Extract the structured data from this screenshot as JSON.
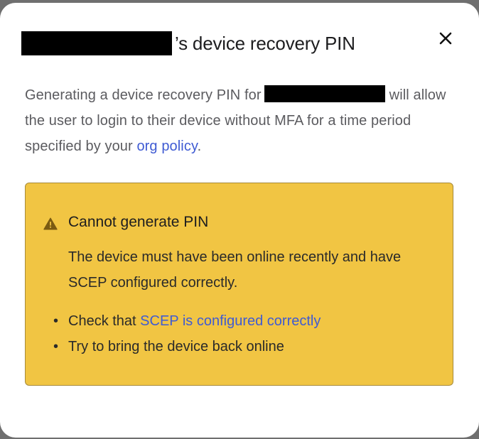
{
  "dialog": {
    "title_suffix": "’s device recovery PIN",
    "close_icon": "close-icon",
    "description": {
      "part1": "Generating a device recovery PIN for",
      "part2": "will allow the user to login to their device without MFA for a time period specified by your",
      "link_text": "org policy",
      "part3": "."
    }
  },
  "alert": {
    "icon": "warning-triangle-icon",
    "heading": "Cannot generate PIN",
    "body": "The device must have been online recently and have SCEP configured correctly.",
    "items": [
      {
        "prefix": "Check that ",
        "link_text": "SCEP is configured correctly",
        "suffix": ""
      },
      {
        "prefix": "Try to bring the device back online",
        "link_text": "",
        "suffix": ""
      }
    ]
  },
  "colors": {
    "alert_background": "#f1c543",
    "alert_border": "#a68a3a",
    "link": "#3f5bd3",
    "backdrop": "#6f6f6f"
  }
}
